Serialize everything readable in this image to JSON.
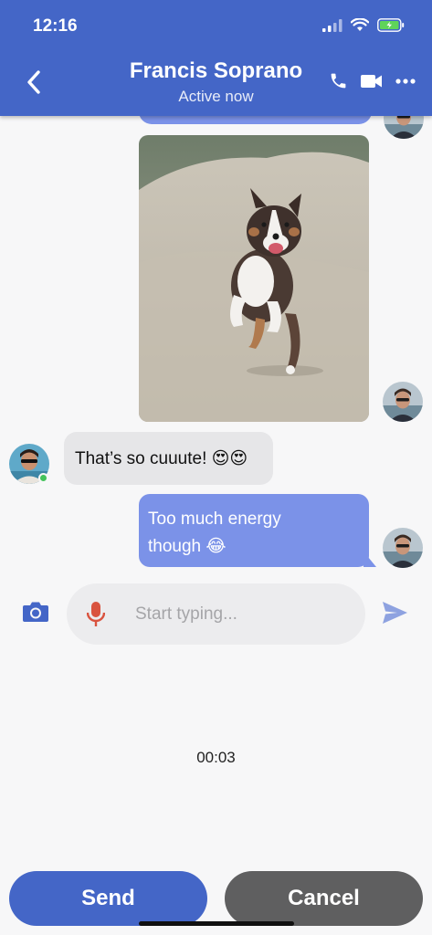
{
  "status_bar": {
    "time": "12:16"
  },
  "header": {
    "title": "Francis Soprano",
    "subtitle": "Active now",
    "background": "#4466c7",
    "icons": [
      "back-chevron",
      "phone",
      "video-camera",
      "more-horizontal"
    ]
  },
  "messages": {
    "incoming_text": "That’s so cuuute! 😍😍",
    "outgoing_line1": "Too much energy",
    "outgoing_line2": "though 😂",
    "outgoing_bubble_color": "#7b92e8",
    "incoming_bubble_color": "#e6e6e8"
  },
  "composer": {
    "placeholder": "Start typing...",
    "icons": [
      "camera",
      "microphone",
      "send-arrow"
    ]
  },
  "recording": {
    "timer": "00:03"
  },
  "actions": {
    "send_label": "Send",
    "cancel_label": "Cancel"
  }
}
